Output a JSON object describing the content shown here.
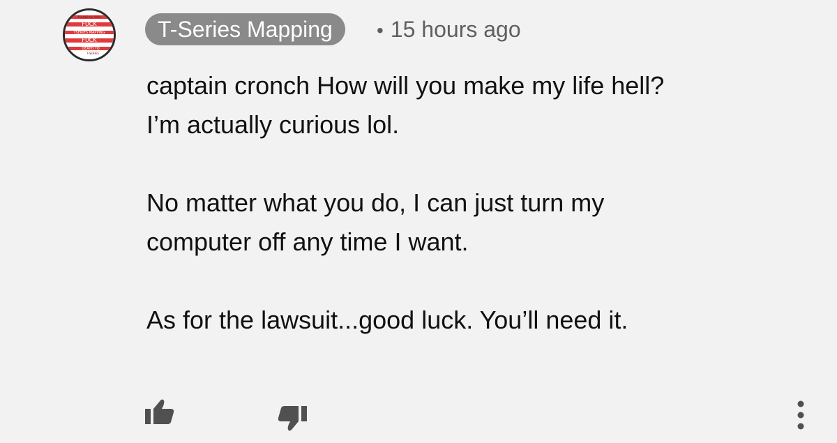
{
  "comment": {
    "author": "T-Series Mapping",
    "separator": "•",
    "timestamp": "15 hours ago",
    "paragraphs": [
      {
        "line1": "captain cronch How will you make my life hell?",
        "line2": "I’m actually curious lol."
      },
      {
        "line1": "No matter what you do, I can just turn my",
        "line2": "computer off any time I want."
      },
      {
        "line1": "As for the lawsuit...good luck. You’ll need it."
      }
    ]
  },
  "avatar": {
    "lines": [
      "Mapping dies",
      "FUCK",
      "TSERIES MAPPING",
      "FUCK",
      "DEATH TO",
      "T-SERIES"
    ]
  },
  "actions": {
    "like_icon": "thumbs-up-icon",
    "dislike_icon": "thumbs-down-icon",
    "more_icon": "more-vertical-icon"
  },
  "colors": {
    "background": "#f2f2f2",
    "author_pill": "#8a8a8a",
    "avatar_stripe": "#e03a3a",
    "icon": "#505050"
  }
}
